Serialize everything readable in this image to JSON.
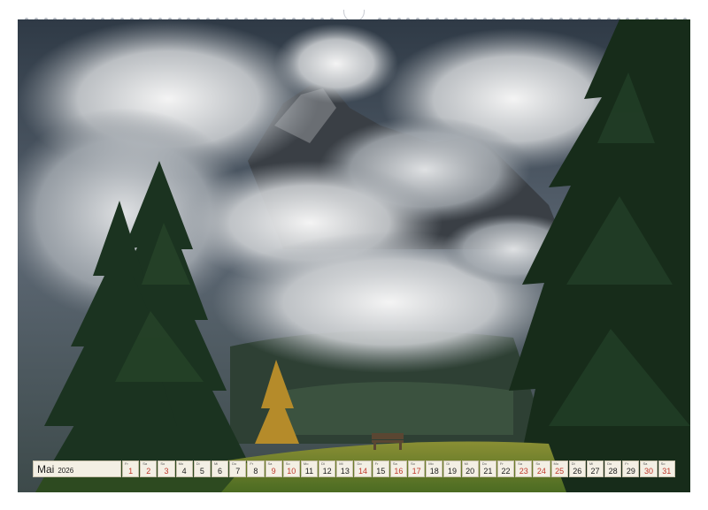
{
  "calendar": {
    "month": "Mai",
    "year": "2026",
    "days": [
      {
        "dow": "Fr",
        "num": "1",
        "red": true
      },
      {
        "dow": "Sa",
        "num": "2",
        "red": true
      },
      {
        "dow": "So",
        "num": "3",
        "red": true
      },
      {
        "dow": "Mo",
        "num": "4",
        "red": false
      },
      {
        "dow": "Di",
        "num": "5",
        "red": false
      },
      {
        "dow": "Mi",
        "num": "6",
        "red": false
      },
      {
        "dow": "Do",
        "num": "7",
        "red": false
      },
      {
        "dow": "Fr",
        "num": "8",
        "red": false
      },
      {
        "dow": "Sa",
        "num": "9",
        "red": true
      },
      {
        "dow": "So",
        "num": "10",
        "red": true
      },
      {
        "dow": "Mo",
        "num": "11",
        "red": false
      },
      {
        "dow": "Di",
        "num": "12",
        "red": false
      },
      {
        "dow": "Mi",
        "num": "13",
        "red": false
      },
      {
        "dow": "Do",
        "num": "14",
        "red": true
      },
      {
        "dow": "Fr",
        "num": "15",
        "red": false
      },
      {
        "dow": "Sa",
        "num": "16",
        "red": true
      },
      {
        "dow": "So",
        "num": "17",
        "red": true
      },
      {
        "dow": "Mo",
        "num": "18",
        "red": false
      },
      {
        "dow": "Di",
        "num": "19",
        "red": false
      },
      {
        "dow": "Mi",
        "num": "20",
        "red": false
      },
      {
        "dow": "Do",
        "num": "21",
        "red": false
      },
      {
        "dow": "Fr",
        "num": "22",
        "red": false
      },
      {
        "dow": "Sa",
        "num": "23",
        "red": true
      },
      {
        "dow": "So",
        "num": "24",
        "red": true
      },
      {
        "dow": "Mo",
        "num": "25",
        "red": true
      },
      {
        "dow": "Di",
        "num": "26",
        "red": false
      },
      {
        "dow": "Mi",
        "num": "27",
        "red": false
      },
      {
        "dow": "Do",
        "num": "28",
        "red": false
      },
      {
        "dow": "Fr",
        "num": "29",
        "red": false
      },
      {
        "dow": "Sa",
        "num": "30",
        "red": true
      },
      {
        "dow": "So",
        "num": "31",
        "red": true
      }
    ]
  },
  "colors": {
    "holiday": "#c0392b",
    "cell_bg": "#f3efe4",
    "sky": "#3b4654",
    "forest": "#1d3320"
  }
}
